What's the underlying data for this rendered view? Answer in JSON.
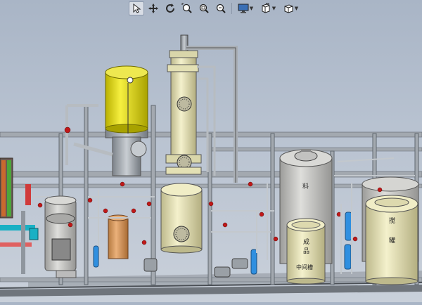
{
  "toolbar": {
    "buttons": [
      {
        "id": "select",
        "icon": "cursor-icon",
        "active": true
      },
      {
        "id": "pan",
        "icon": "move-icon"
      },
      {
        "id": "rotate",
        "icon": "rotate-icon"
      },
      {
        "id": "zoom-fit",
        "icon": "zoom-fit-icon"
      },
      {
        "id": "zoom-area",
        "icon": "zoom-area-icon"
      },
      {
        "id": "zoom-in-out",
        "icon": "zoom-in-out-icon"
      },
      {
        "id": "display",
        "icon": "monitor-icon",
        "dropdown": true
      },
      {
        "id": "section",
        "icon": "section-view-icon",
        "dropdown": true
      },
      {
        "id": "view-orientation",
        "icon": "cube-view-icon",
        "dropdown": true
      }
    ]
  },
  "tank_labels": {
    "mid_tank_top": "成",
    "mid_tank_mid": "品",
    "mid_tank_line": "中间槽",
    "right_tank_top": "搅",
    "right_tank_bottom": "罐",
    "gray_tank": "料"
  },
  "colors": {
    "yellow_tank": "#e8e020",
    "cream_vessel": "#e9e6b8",
    "gray_tank": "#c9c9c6",
    "orange_tank": "#d99b5e",
    "frame": "#8f969e",
    "pipe": "#aeb4ba",
    "blue_pump": "#2f8fe0",
    "red_valve": "#c01818",
    "cyan_pipe": "#18b0c4"
  }
}
